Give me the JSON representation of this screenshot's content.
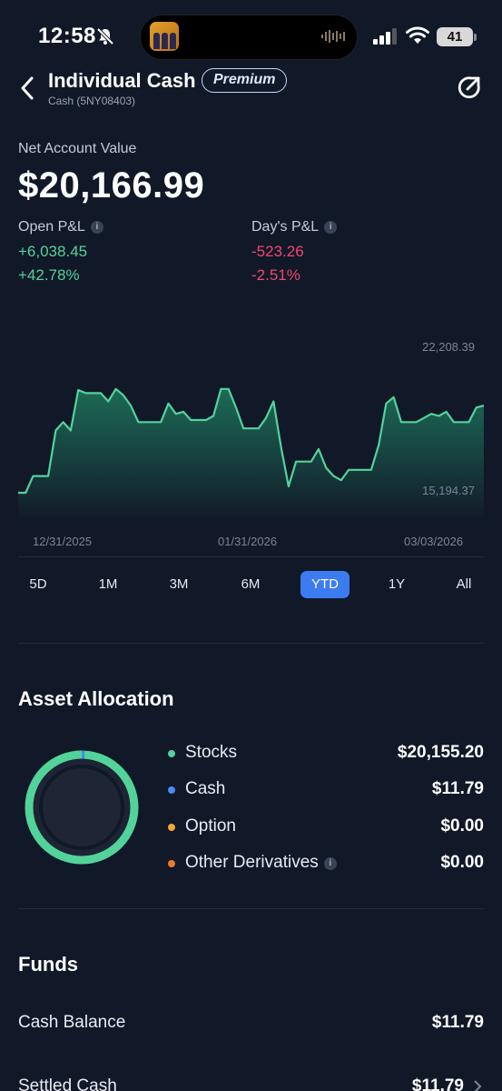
{
  "status_bar": {
    "time": "12:58",
    "battery": "41",
    "icons": [
      "bell-slash-icon",
      "signal-icon",
      "wifi-icon",
      "battery-icon"
    ]
  },
  "header": {
    "title": "Individual Cash",
    "badge": "Premium",
    "subtitle": "Cash (5NY08403)"
  },
  "account": {
    "net_label": "Net Account Value",
    "net_value": "$20,166.99",
    "open_pl_label": "Open P&L",
    "open_pl_value": "+6,038.45",
    "open_pl_pct": "+42.78%",
    "day_pl_label": "Day's P&L",
    "day_pl_value": "-523.26",
    "day_pl_pct": "-2.51%",
    "info_glyph": "i"
  },
  "chart_data": {
    "type": "area",
    "y_max_label": "22,208.39",
    "y_min_label": "15,194.37",
    "x_tick_labels": [
      "12/31/2025",
      "01/31/2026",
      "03/03/2026"
    ],
    "ylim": [
      15194.37,
      22208.39
    ],
    "values": [
      15194,
      15194,
      16000,
      16000,
      16000,
      18200,
      18600,
      18200,
      20150,
      20000,
      20000,
      20000,
      19600,
      20200,
      19900,
      19400,
      18600,
      18600,
      18600,
      18600,
      19500,
      19000,
      19100,
      18700,
      18700,
      18700,
      18900,
      20200,
      20200,
      19300,
      18300,
      18300,
      18300,
      18800,
      19600,
      17400,
      15500,
      16700,
      16700,
      16700,
      17300,
      16400,
      16000,
      15800,
      16300,
      16300,
      16300,
      16300,
      17500,
      19500,
      19800,
      18600,
      18600,
      18600,
      18800,
      19000,
      18900,
      19100,
      18600,
      18600,
      18600,
      19300,
      19400
    ],
    "line_color": "#52d39a"
  },
  "range_tabs": {
    "items": [
      "5D",
      "1M",
      "3M",
      "6M",
      "YTD",
      "1Y",
      "All"
    ],
    "active": "YTD"
  },
  "asset_allocation": {
    "title": "Asset Allocation",
    "items": [
      {
        "name": "Stocks",
        "amount": "$20,155.20",
        "color": "#52d39a"
      },
      {
        "name": "Cash",
        "amount": "$11.79",
        "color": "#4a8cf2"
      },
      {
        "name": "Option",
        "amount": "$0.00",
        "color": "#f0a83a"
      },
      {
        "name": "Other Derivatives",
        "amount": "$0.00",
        "color": "#f07a2a"
      }
    ],
    "stocks_fraction": 0.9994
  },
  "funds": {
    "title": "Funds",
    "rows": [
      {
        "label": "Cash Balance",
        "value": "$11.79"
      },
      {
        "label": "Settled Cash",
        "value": "$11.79"
      }
    ]
  }
}
